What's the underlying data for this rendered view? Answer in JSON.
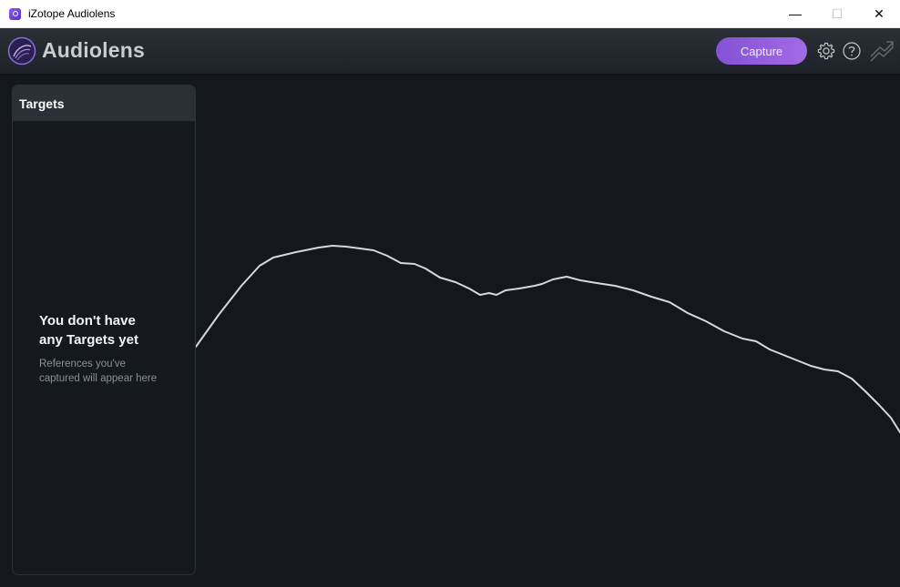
{
  "window": {
    "title": "iZotope Audiolens",
    "minimize_glyph": "—",
    "maximize_glyph": "☐",
    "close_glyph": "✕"
  },
  "header": {
    "brand": "Audiolens",
    "capture_label": "Capture",
    "icons": [
      "audiolens-logo-icon",
      "gear-icon",
      "help-icon",
      "link-icon"
    ]
  },
  "targets": {
    "title": "Targets",
    "empty_title_line1": "You don't have",
    "empty_title_line2": "any Targets yet",
    "empty_sub_line1": "References you've",
    "empty_sub_line2": "captured will appear here"
  },
  "colors": {
    "accent_start": "#8452d6",
    "accent_end": "#a26ae6",
    "curve": "#d6d8dc",
    "background": "#14171b"
  }
}
